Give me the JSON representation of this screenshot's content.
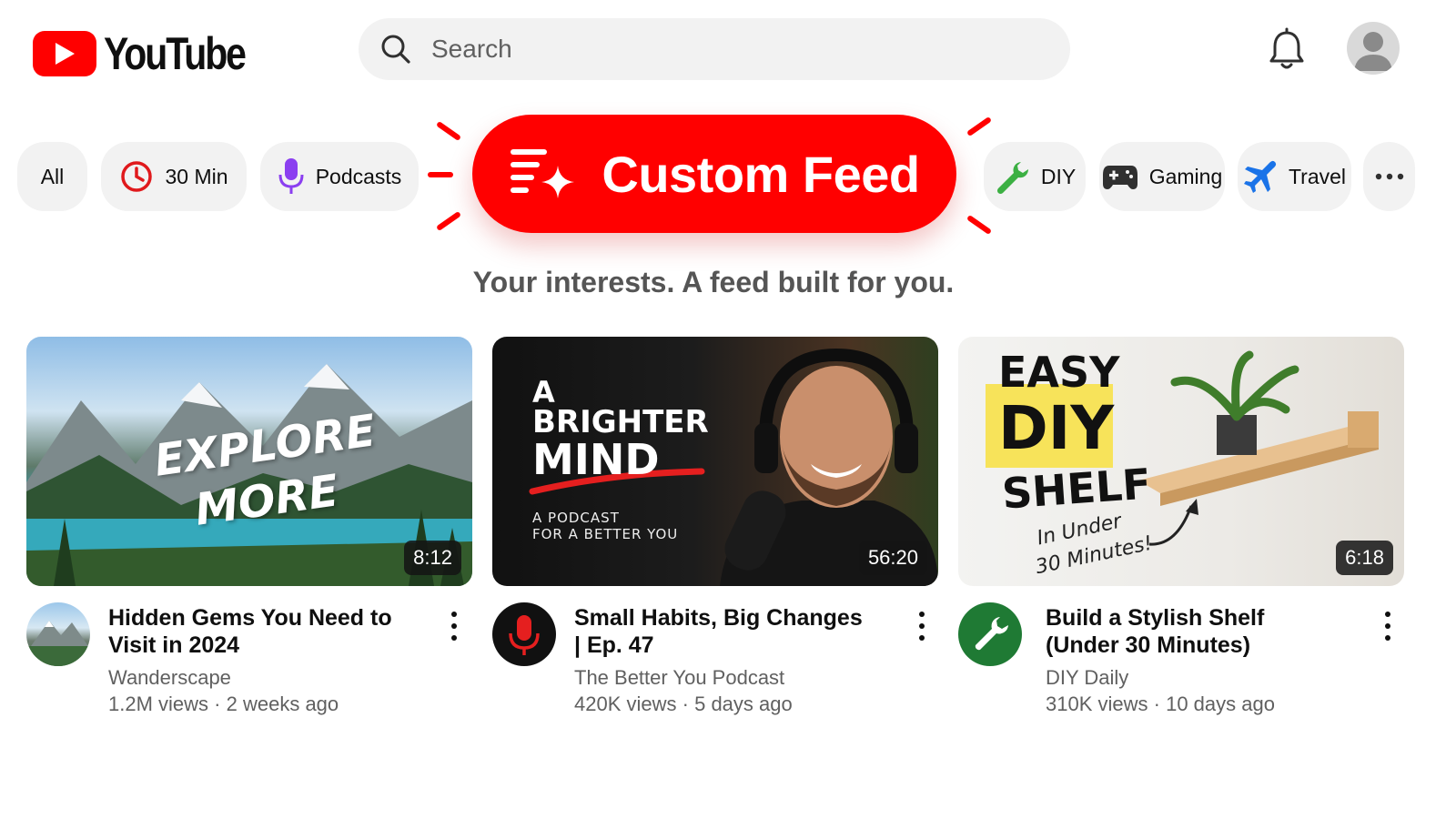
{
  "header": {
    "logo_text": "YouTube",
    "search_placeholder": "Search"
  },
  "chips": [
    {
      "label": "All",
      "icon": "none"
    },
    {
      "label": "30 Min",
      "icon": "clock-icon"
    },
    {
      "label": "Podcasts",
      "icon": "microphone-icon"
    },
    {
      "label": "DIY",
      "icon": "wrench-icon"
    },
    {
      "label": "Gaming",
      "icon": "gamepad-icon"
    },
    {
      "label": "Travel",
      "icon": "airplane-icon"
    }
  ],
  "custom_feed": {
    "label": "Custom Feed",
    "icon": "sparkle-list-icon",
    "tagline": "Your interests. A feed built for you."
  },
  "colors": {
    "brand_red": "#ff0000",
    "chip_bg": "#f2f2f2",
    "secondary_text": "#606060"
  },
  "videos": [
    {
      "title": "Hidden Gems You Need to Visit in 2024",
      "channel": "Wanderscape",
      "views": "1.2M views",
      "age": "2 weeks ago",
      "duration": "8:12",
      "thumb_text": [
        "EXPLORE",
        "MORE"
      ]
    },
    {
      "title": "Small Habits, Big Changes | Ep. 47",
      "channel": "The Better You Podcast",
      "views": "420K views",
      "age": "5 days ago",
      "duration": "56:20",
      "thumb_text": [
        "A",
        "BRIGHTER",
        "MIND",
        "A PODCAST",
        "FOR A BETTER YOU"
      ]
    },
    {
      "title": "Build a Stylish Shelf (Under 30 Minutes)",
      "channel": "DIY Daily",
      "views": "310K views",
      "age": "10 days ago",
      "duration": "6:18",
      "thumb_text": [
        "EASY",
        "DIY",
        "SHELF",
        "In Under",
        "30 Minutes!"
      ]
    }
  ]
}
